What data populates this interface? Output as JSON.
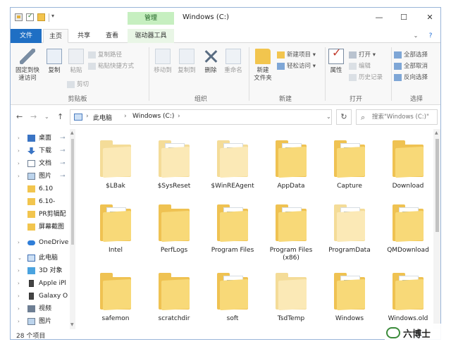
{
  "window": {
    "title": "Windows (C:)",
    "manage_label": "管理",
    "min": "—",
    "max": "☐",
    "close": "✕"
  },
  "tabs": {
    "file": "文件",
    "home": "主页",
    "share": "共享",
    "view": "查看",
    "drive_tools": "驱动器工具",
    "help": "?",
    "expand": "⌄"
  },
  "ribbon": {
    "clipboard": {
      "label": "剪贴板",
      "pin": "固定到快\n速访问",
      "copy": "复制",
      "paste": "粘贴",
      "copy_path": "复制路径",
      "paste_shortcut": "粘贴快捷方式",
      "cut": "剪切"
    },
    "organize": {
      "label": "组织",
      "move_to": "移动到",
      "copy_to": "复制到",
      "delete": "删除",
      "rename": "重命名"
    },
    "new": {
      "label": "新建",
      "new_folder": "新建\n文件夹",
      "new_item": "新建项目 ▾",
      "easy_access": "轻松访问 ▾"
    },
    "open": {
      "label": "打开",
      "properties": "属性",
      "open": "打开 ▾",
      "edit": "编辑",
      "history": "历史记录"
    },
    "select": {
      "label": "选择",
      "select_all": "全部选择",
      "select_none": "全部取消",
      "invert": "反向选择"
    }
  },
  "address": {
    "crumbs": [
      "此电脑",
      "Windows (C:)"
    ],
    "search_placeholder": "搜索\"Windows (C:)\"",
    "back": "←",
    "forward": "→",
    "recent": "⌄",
    "up": "↑",
    "refresh": "↻",
    "chevron": "›",
    "dropdown": "⌄"
  },
  "nav": {
    "items": [
      {
        "label": "桌面",
        "pinned": true
      },
      {
        "label": "下载",
        "pinned": true
      },
      {
        "label": "文档",
        "pinned": true
      },
      {
        "label": "图片",
        "pinned": true
      },
      {
        "label": "6.10"
      },
      {
        "label": "6.10-"
      },
      {
        "label": "PR剪辑配"
      },
      {
        "label": "屏幕截图"
      },
      {
        "label": "OneDrive"
      },
      {
        "label": "此电脑"
      },
      {
        "label": "3D 对象"
      },
      {
        "label": "Apple iPl"
      },
      {
        "label": "Galaxy O"
      },
      {
        "label": "视频"
      },
      {
        "label": "图片"
      }
    ],
    "pin_glyph": "📌"
  },
  "files": [
    {
      "name": "$LBak",
      "faded": true
    },
    {
      "name": "$SysReset",
      "faded": true
    },
    {
      "name": "$WinREAgent",
      "faded": true
    },
    {
      "name": "AppData",
      "faded": false
    },
    {
      "name": "Capture",
      "faded": false
    },
    {
      "name": "Download",
      "faded": false
    },
    {
      "name": "Intel",
      "faded": false
    },
    {
      "name": "PerfLogs",
      "faded": false
    },
    {
      "name": "Program Files",
      "faded": false
    },
    {
      "name": "Program Files\n(x86)",
      "faded": false
    },
    {
      "name": "ProgramData",
      "faded": true
    },
    {
      "name": "QMDownload",
      "faded": false
    },
    {
      "name": "safemon",
      "faded": false
    },
    {
      "name": "scratchdir",
      "faded": false
    },
    {
      "name": "soft",
      "faded": false
    },
    {
      "name": "TsdTemp",
      "faded": true
    },
    {
      "name": "Windows",
      "faded": false
    },
    {
      "name": "Windows.old",
      "faded": false
    }
  ],
  "status": {
    "count": "28 个项目"
  },
  "watermark": {
    "text": "六博士"
  },
  "colors": {
    "accent": "#1f6fc4",
    "manage_tab": "#c6efc0",
    "folder": "#efc252"
  }
}
